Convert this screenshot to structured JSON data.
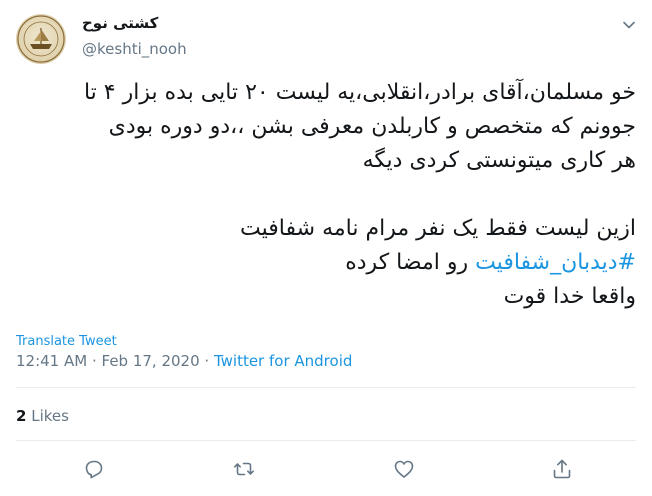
{
  "author": {
    "name": "کشتی نوح",
    "handle": "@keshti_nooh"
  },
  "tweet": {
    "line1": "خو مسلمان،آقای برادر،انقلابی،یه لیست ۲۰ تایی بده بزار ۴ تا",
    "line2": "جوونم که متخصص و کاربلدن معرفی بشن ،،دو دوره بودی",
    "line3": "هر کاری میتونستی کردی دیگه",
    "line4": "ازین لیست فقط یک نفر مرام نامه شفافیت",
    "hashtag": "#دیدبان_شفافیت",
    "line5_rest": " رو امضا کرده",
    "line6": "واقعا خدا قوت"
  },
  "translate_label": "Translate Tweet",
  "meta": {
    "time": "12:41 AM",
    "sep1": " · ",
    "date": "Feb 17, 2020",
    "sep2": " · ",
    "source": "Twitter for Android"
  },
  "likes": {
    "count": "2",
    "label": "Likes"
  },
  "actions": {
    "reply_icon": "reply-icon",
    "retweet_icon": "retweet-icon",
    "like_icon": "heart-icon",
    "share_icon": "share-icon"
  },
  "colors": {
    "link": "#1b95e0",
    "muted": "#657786",
    "text": "#14171a",
    "divider": "#e6ecf0"
  }
}
